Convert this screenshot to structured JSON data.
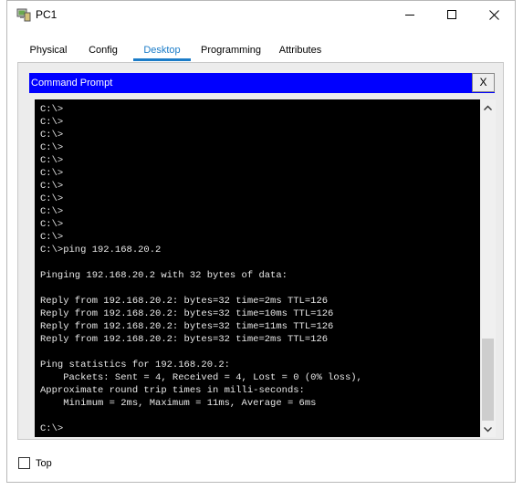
{
  "window": {
    "title": "PC1",
    "icons": {
      "app": "pc-icon",
      "minimize": "minimize-icon",
      "maximize": "maximize-icon",
      "close": "close-icon"
    }
  },
  "tabs": [
    {
      "label": "Physical",
      "active": false
    },
    {
      "label": "Config",
      "active": false
    },
    {
      "label": "Desktop",
      "active": true
    },
    {
      "label": "Programming",
      "active": false
    },
    {
      "label": "Attributes",
      "active": false
    }
  ],
  "command_prompt": {
    "title": "Command Prompt",
    "close_label": "X",
    "output": "C:\\>\nC:\\>\nC:\\>\nC:\\>\nC:\\>\nC:\\>\nC:\\>\nC:\\>\nC:\\>\nC:\\>\nC:\\>\nC:\\>ping 192.168.20.2\n\nPinging 192.168.20.2 with 32 bytes of data:\n\nReply from 192.168.20.2: bytes=32 time=2ms TTL=126\nReply from 192.168.20.2: bytes=32 time=10ms TTL=126\nReply from 192.168.20.2: bytes=32 time=11ms TTL=126\nReply from 192.168.20.2: bytes=32 time=2ms TTL=126\n\nPing statistics for 192.168.20.2:\n    Packets: Sent = 4, Received = 4, Lost = 0 (0% loss),\nApproximate round trip times in milli-seconds:\n    Minimum = 2ms, Maximum = 11ms, Average = 6ms\n\nC:\\>",
    "scroll_position": 0.85
  },
  "footer": {
    "top_label": "Top",
    "top_checked": false
  },
  "colors": {
    "accent": "#1b7cc8",
    "header_bg": "#0000ff",
    "console_bg": "#000000",
    "console_fg": "#e8e8e8"
  }
}
